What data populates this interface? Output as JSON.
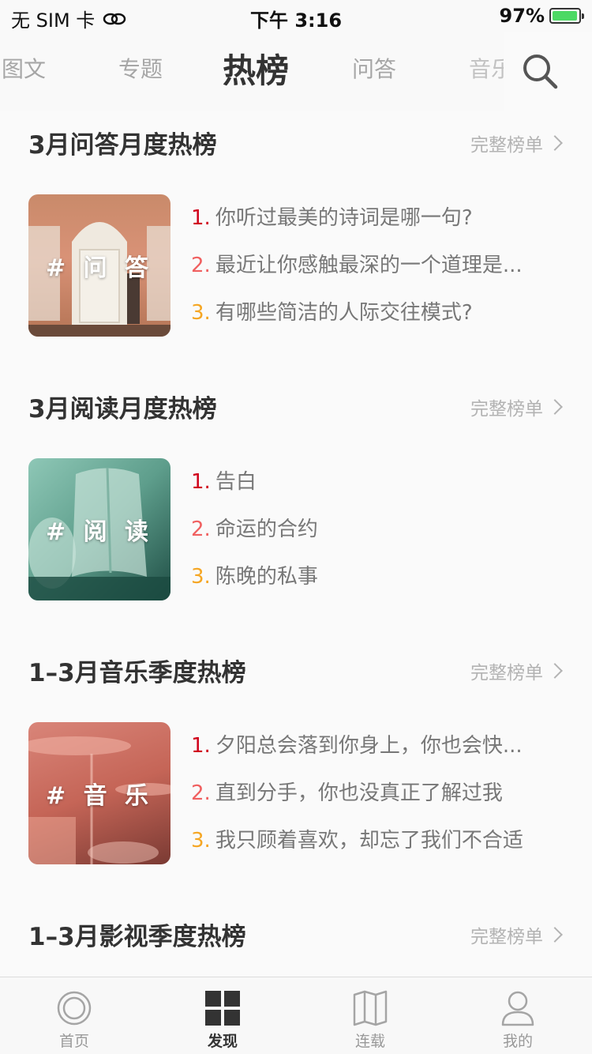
{
  "status": {
    "carrier": "无 SIM 卡",
    "time": "下午 3:16",
    "battery": "97%",
    "battery_level": 0.97
  },
  "top_tabs": [
    {
      "label": "图文"
    },
    {
      "label": "专题"
    },
    {
      "label": "热榜",
      "active": true
    },
    {
      "label": "问答"
    },
    {
      "label": "音乐"
    }
  ],
  "sections": [
    {
      "title": "3月问答月度热榜",
      "more": "完整榜单",
      "cover_label": "# 问 答",
      "items": [
        {
          "num": "1.",
          "text": "你听过最美的诗词是哪一句?"
        },
        {
          "num": "2.",
          "text": "最近让你感触最深的一个道理是..."
        },
        {
          "num": "3.",
          "text": "有哪些简洁的人际交往模式?"
        }
      ]
    },
    {
      "title": "3月阅读月度热榜",
      "more": "完整榜单",
      "cover_label": "# 阅 读",
      "items": [
        {
          "num": "1.",
          "text": "告白"
        },
        {
          "num": "2.",
          "text": "命运的合约"
        },
        {
          "num": "3.",
          "text": "陈晚的私事"
        }
      ]
    },
    {
      "title": "1–3月音乐季度热榜",
      "more": "完整榜单",
      "cover_label": "# 音 乐",
      "items": [
        {
          "num": "1.",
          "text": "夕阳总会落到你身上，你也会快..."
        },
        {
          "num": "2.",
          "text": "直到分手，你也没真正了解过我"
        },
        {
          "num": "3.",
          "text": "我只顾着喜欢，却忘了我们不合适"
        }
      ]
    },
    {
      "title": "1–3月影视季度热榜",
      "more": "完整榜单"
    }
  ],
  "rank_colors": [
    "#d0021b",
    "#f06060",
    "#f5a623"
  ],
  "tab_bar": [
    {
      "label": "首页",
      "icon": "home-circle-icon"
    },
    {
      "label": "发现",
      "icon": "grid-icon",
      "active": true
    },
    {
      "label": "连载",
      "icon": "book-icon"
    },
    {
      "label": "我的",
      "icon": "person-icon"
    }
  ]
}
